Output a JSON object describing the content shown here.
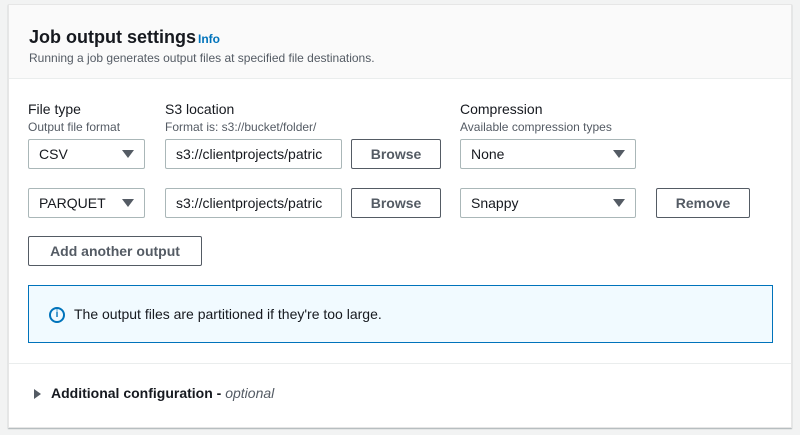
{
  "header": {
    "title": "Job output settings",
    "info_label": "Info",
    "description": "Running a job generates output files at specified file destinations."
  },
  "columns": {
    "file_type": {
      "label": "File type",
      "sublabel": "Output file format"
    },
    "s3_location": {
      "label": "S3 location",
      "sublabel": "Format is: s3://bucket/folder/"
    },
    "compression": {
      "label": "Compression",
      "sublabel": "Available compression types"
    }
  },
  "outputs": [
    {
      "file_type": "CSV",
      "s3_location": "s3://clientprojects/patric",
      "browse_label": "Browse",
      "compression": "None"
    },
    {
      "file_type": "PARQUET",
      "s3_location": "s3://clientprojects/patric",
      "browse_label": "Browse",
      "compression": "Snappy",
      "remove_label": "Remove"
    }
  ],
  "add_output_label": "Add another output",
  "alert": {
    "icon": "info-icon",
    "glyph": "i",
    "text": "The output files are partitioned if they're too large."
  },
  "additional_config": {
    "label": "Additional configuration",
    "separator": " - ",
    "optional": "optional"
  }
}
